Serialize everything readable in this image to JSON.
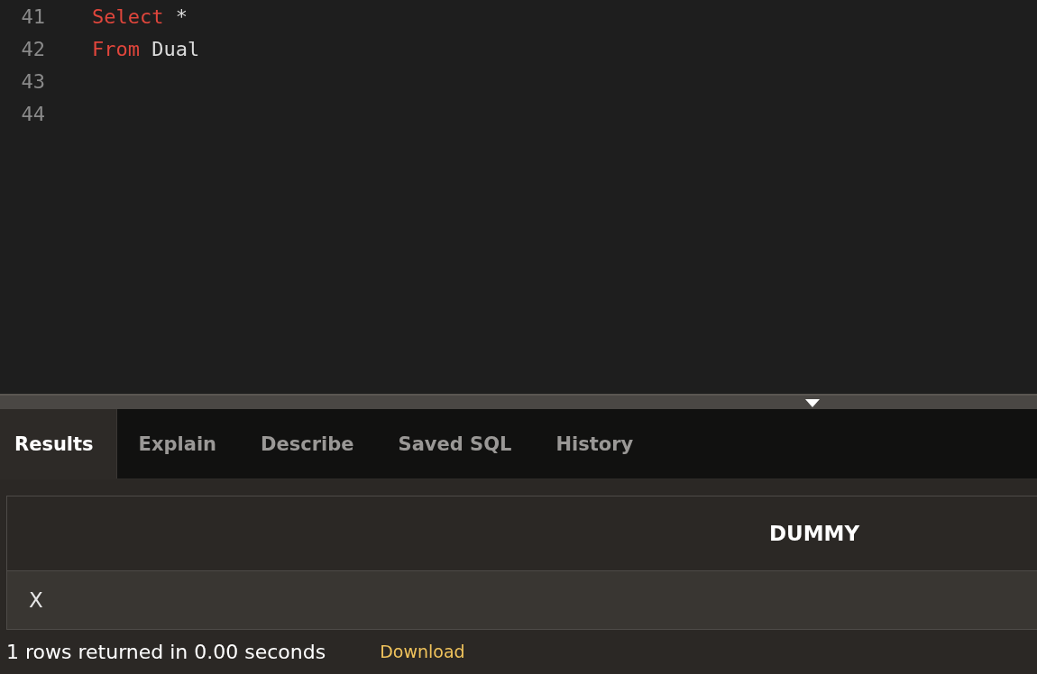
{
  "editor": {
    "lines": [
      {
        "number": "41",
        "tokens": [
          {
            "kind": "keyword",
            "text": "Select"
          },
          {
            "kind": "plain",
            "text": " *"
          }
        ]
      },
      {
        "number": "42",
        "tokens": [
          {
            "kind": "keyword",
            "text": "From"
          },
          {
            "kind": "plain",
            "text": " Dual"
          }
        ]
      },
      {
        "number": "43"
      },
      {
        "number": "44"
      }
    ]
  },
  "tabs": [
    {
      "label": "Results",
      "selected": true
    },
    {
      "label": "Explain",
      "selected": false
    },
    {
      "label": "Describe",
      "selected": false
    },
    {
      "label": "Saved SQL",
      "selected": false
    },
    {
      "label": "History",
      "selected": false
    }
  ],
  "table": {
    "columns": [
      "DUMMY"
    ],
    "rows": [
      [
        "X"
      ]
    ]
  },
  "status": {
    "message": "1 rows returned in 0.00 seconds",
    "link": "Download"
  }
}
